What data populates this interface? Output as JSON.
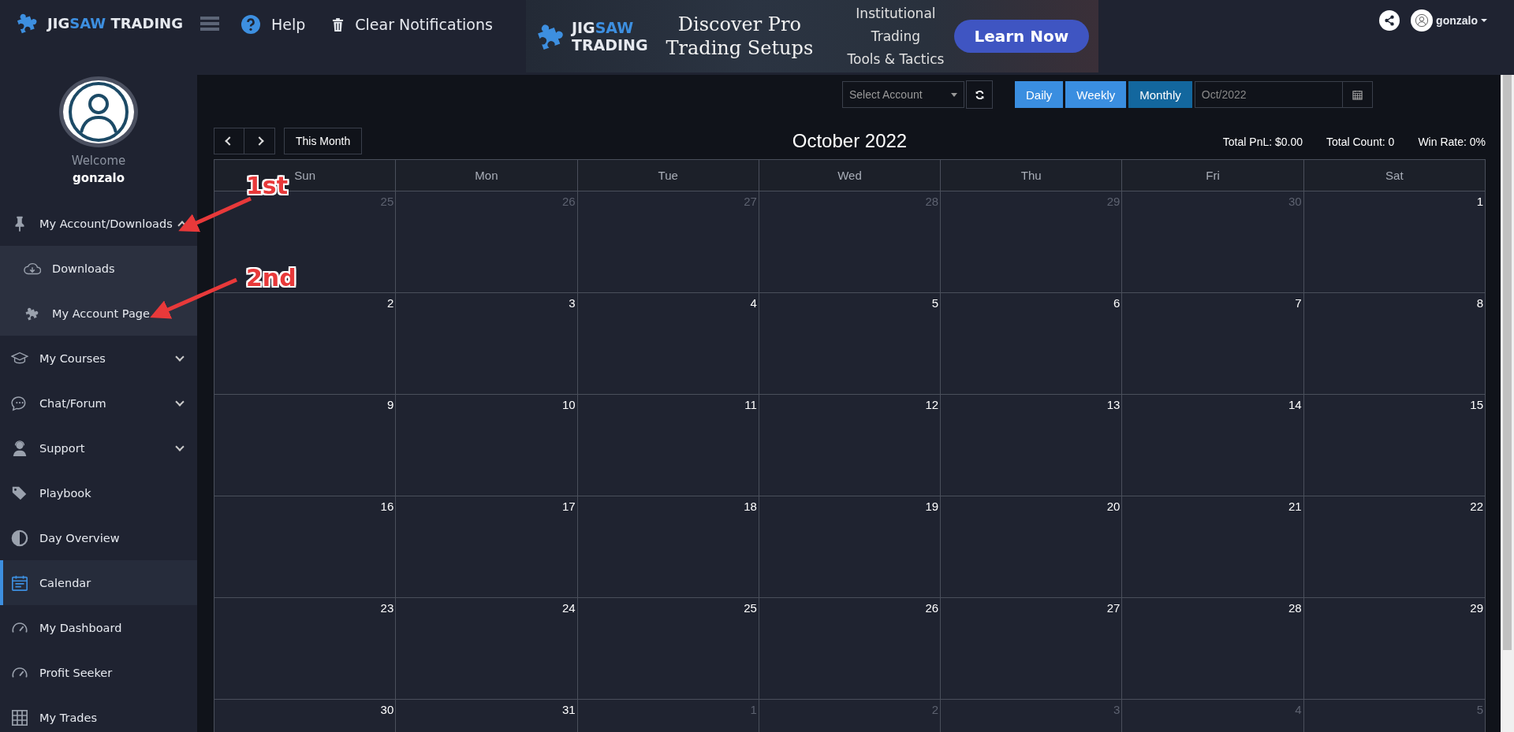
{
  "topbar": {
    "logo": {
      "lead": "JIG",
      "accent": "SAW",
      "trail": " TRADING"
    },
    "help": "Help",
    "clear_notifications": "Clear Notifications",
    "user": "gonzalo"
  },
  "banner": {
    "logo": {
      "lead": "JIG",
      "accent": "SAW",
      "trail": "TRADING"
    },
    "headline": "Discover Pro Trading Setups",
    "tagline": [
      "Institutional",
      "Trading",
      "Tools & Tactics"
    ],
    "button": "Learn Now"
  },
  "sidebar": {
    "welcome": "Welcome",
    "username": "gonzalo",
    "items": [
      {
        "label": "My Account/Downloads",
        "selected": false,
        "expanded": true,
        "children": [
          {
            "label": "Downloads",
            "selected": false
          },
          {
            "label": "My Account Page",
            "selected": false
          }
        ]
      },
      {
        "label": "My Courses",
        "selected": false,
        "expanded": false
      },
      {
        "label": "Chat/Forum",
        "selected": false,
        "expanded": false
      },
      {
        "label": "Support",
        "selected": false,
        "expanded": false
      },
      {
        "label": "Playbook",
        "selected": false
      },
      {
        "label": "Day Overview",
        "selected": false
      },
      {
        "label": "Calendar",
        "selected": true
      },
      {
        "label": "My Dashboard",
        "selected": false
      },
      {
        "label": "Profit Seeker",
        "selected": false
      },
      {
        "label": "My Trades",
        "selected": false
      }
    ]
  },
  "toolbar": {
    "account_select": "Select Account",
    "views": [
      {
        "label": "Daily",
        "selected": false
      },
      {
        "label": "Weekly",
        "selected": false
      },
      {
        "label": "Monthly",
        "selected": true
      }
    ],
    "date": "Oct/2022",
    "this_month": "This Month"
  },
  "calendar": {
    "title": "October 2022",
    "stats": [
      "Total PnL: $0.00",
      "Total Count: 0",
      "Win Rate: 0%"
    ],
    "weekdays": [
      "Sun",
      "Mon",
      "Tue",
      "Wed",
      "Thu",
      "Fri",
      "Sat"
    ],
    "weeks": [
      [
        {
          "day": "25",
          "in_month": false
        },
        {
          "day": "26",
          "in_month": false
        },
        {
          "day": "27",
          "in_month": false
        },
        {
          "day": "28",
          "in_month": false
        },
        {
          "day": "29",
          "in_month": false
        },
        {
          "day": "30",
          "in_month": false
        },
        {
          "day": "1",
          "in_month": true
        }
      ],
      [
        {
          "day": "2",
          "in_month": true
        },
        {
          "day": "3",
          "in_month": true
        },
        {
          "day": "4",
          "in_month": true
        },
        {
          "day": "5",
          "in_month": true
        },
        {
          "day": "6",
          "in_month": true
        },
        {
          "day": "7",
          "in_month": true
        },
        {
          "day": "8",
          "in_month": true
        }
      ],
      [
        {
          "day": "9",
          "in_month": true
        },
        {
          "day": "10",
          "in_month": true
        },
        {
          "day": "11",
          "in_month": true
        },
        {
          "day": "12",
          "in_month": true
        },
        {
          "day": "13",
          "in_month": true
        },
        {
          "day": "14",
          "in_month": true
        },
        {
          "day": "15",
          "in_month": true
        }
      ],
      [
        {
          "day": "16",
          "in_month": true
        },
        {
          "day": "17",
          "in_month": true
        },
        {
          "day": "18",
          "in_month": true
        },
        {
          "day": "19",
          "in_month": true
        },
        {
          "day": "20",
          "in_month": true
        },
        {
          "day": "21",
          "in_month": true
        },
        {
          "day": "22",
          "in_month": true
        }
      ],
      [
        {
          "day": "23",
          "in_month": true
        },
        {
          "day": "24",
          "in_month": true
        },
        {
          "day": "25",
          "in_month": true
        },
        {
          "day": "26",
          "in_month": true
        },
        {
          "day": "27",
          "in_month": true
        },
        {
          "day": "28",
          "in_month": true
        },
        {
          "day": "29",
          "in_month": true
        }
      ],
      [
        {
          "day": "30",
          "in_month": true
        },
        {
          "day": "31",
          "in_month": true
        },
        {
          "day": "1",
          "in_month": false
        },
        {
          "day": "2",
          "in_month": false
        },
        {
          "day": "3",
          "in_month": false
        },
        {
          "day": "4",
          "in_month": false
        },
        {
          "day": "5",
          "in_month": false
        }
      ]
    ]
  },
  "annotations": [
    "1st",
    "2nd"
  ]
}
